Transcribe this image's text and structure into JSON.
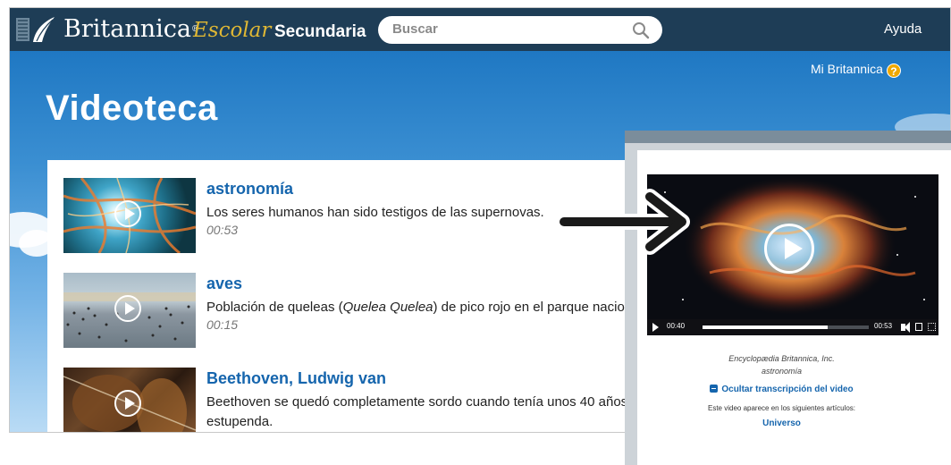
{
  "header": {
    "brand": "Britannica",
    "brand_reg": "®",
    "brand_sub": "Escolar",
    "level": "Secundaria",
    "search_placeholder": "Buscar",
    "help_label": "Ayuda"
  },
  "account": {
    "label": "Mi Britannica",
    "help_glyph": "?"
  },
  "page_title": "Videoteca",
  "videos": [
    {
      "title": "astronomía",
      "description": "Los seres humanos han sido testigos de las supernovas.",
      "duration": "00:53"
    },
    {
      "title": "aves",
      "description_pre": "Población de queleas (",
      "description_italic": "Quelea Quelea",
      "description_post": ") de pico rojo en el parque nacional",
      "duration": "00:15"
    },
    {
      "title": "Beethoven, Ludwig van",
      "description": "Beethoven se quedó completamente sordo cuando tenía unos 40 años",
      "description_line2": "estupenda."
    }
  ],
  "popup": {
    "current_time": "00:40",
    "total_time": "00:53",
    "progress": 0.75,
    "credit": "Encyclopædia Britannica, Inc.",
    "video_name": "astronomía",
    "transcript_toggle": "Ocultar transcripción del video",
    "appears_label": "Este video aparece en los siguientes artículos:",
    "article": "Universo"
  },
  "colors": {
    "header_bg": "#1e3d56",
    "brand_accent": "#e0b834",
    "link_blue": "#1565ad",
    "sky": "#3b8fd2",
    "help_badge": "#f0a800"
  },
  "icons": [
    "britannica-logo-icon",
    "search-icon",
    "help-circle-icon",
    "play-icon",
    "minus-square-icon",
    "volume-icon",
    "fullscreen-icon",
    "arrow-right-icon"
  ]
}
